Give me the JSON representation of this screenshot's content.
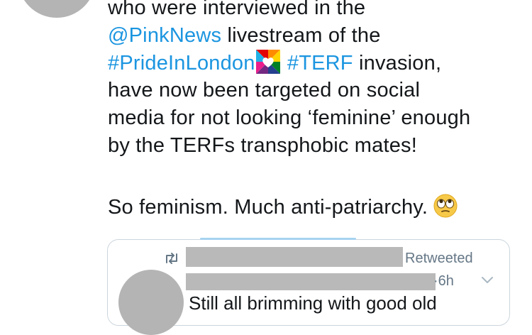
{
  "tweet": {
    "lines": [
      "who were interviewed in the",
      "livestream of the",
      "invasion,",
      "have now been targeted on social",
      "media for not looking ‘feminine’ enough",
      "by the TERFs transphobic mates!",
      "So feminism. Much anti-patriarchy."
    ],
    "mention": "@PinkNews",
    "hashtag_pride": "#PrideInLondon",
    "hashtag_terf": "#TERF",
    "link_color": "#1b95e0",
    "pride_icon": "pride-heart-icon",
    "emoji": "face-with-rolling-eyes-icon"
  },
  "quoted_tweet": {
    "retweeted_label": "Retweeted",
    "time": "·6h",
    "text": "Still all brimming with good old",
    "retweet_icon": "retweet-icon",
    "menu_icon": "chevron-down-icon"
  }
}
